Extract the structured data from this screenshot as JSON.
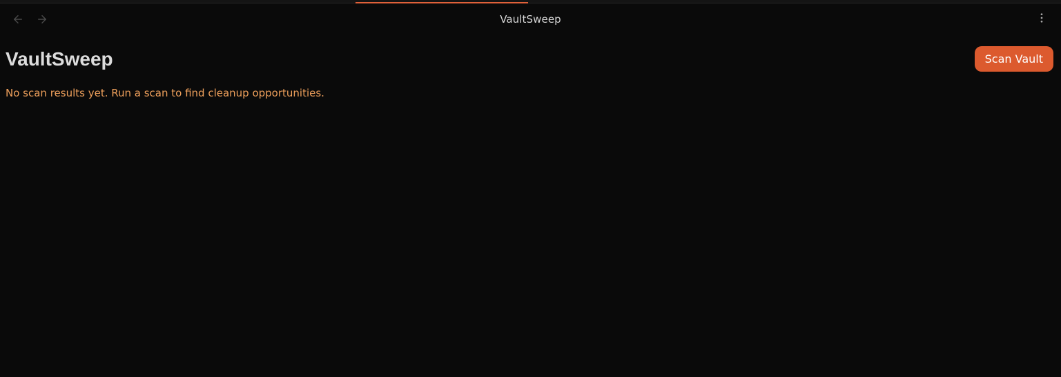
{
  "header": {
    "view_title": "VaultSweep",
    "back_icon": "arrow-left-icon",
    "forward_icon": "arrow-right-icon",
    "more_icon": "more-vertical-icon"
  },
  "main": {
    "title": "VaultSweep",
    "scan_button_label": "Scan Vault",
    "status_message": "No scan results yet. Run a scan to find cleanup opportunities."
  },
  "colors": {
    "background": "#0a0a0a",
    "accent": "#dc5a2e",
    "status_text": "#f0a15c",
    "title_text": "#dcdcdc"
  }
}
